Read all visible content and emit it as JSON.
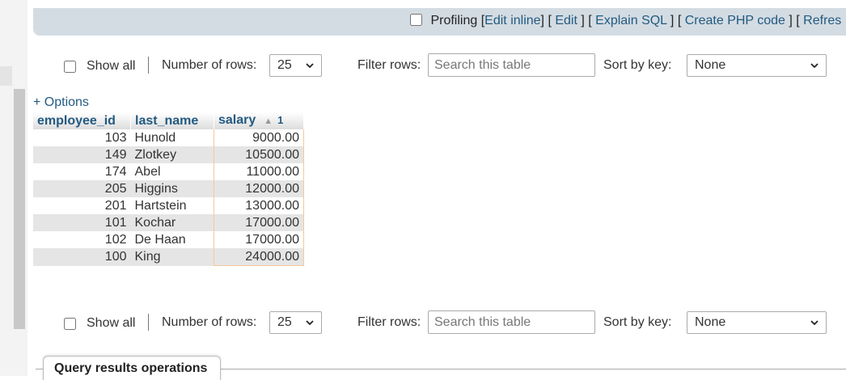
{
  "profiling": {
    "label": "Profiling",
    "bracket_open": "[",
    "links": [
      {
        "text": "Edit inline",
        "suffix": "] [ "
      },
      {
        "text": "Edit",
        "suffix": " ] [ "
      },
      {
        "text": "Explain SQL",
        "suffix": " ] [ "
      },
      {
        "text": "Create PHP code",
        "suffix": " ] [ "
      },
      {
        "text": "Refres",
        "suffix": ""
      }
    ]
  },
  "nav_top": {
    "show_all": "Show all",
    "number_of_rows_label": "Number of rows:",
    "number_of_rows_value": "25",
    "filter_label": "Filter rows:",
    "filter_placeholder": "Search this table",
    "sort_label": "Sort by key:",
    "sort_value": "None"
  },
  "nav_bottom": {
    "show_all": "Show all",
    "number_of_rows_label": "Number of rows:",
    "number_of_rows_value": "25",
    "filter_label": "Filter rows:",
    "filter_placeholder": "Search this table",
    "sort_label": "Sort by key:",
    "sort_value": "None"
  },
  "options_link": "+ Options",
  "table": {
    "columns": [
      "employee_id",
      "last_name",
      "salary"
    ],
    "sort_order_number": "1",
    "rows": [
      {
        "employee_id": "103",
        "last_name": "Hunold",
        "salary": "9000.00"
      },
      {
        "employee_id": "149",
        "last_name": "Zlotkey",
        "salary": "10500.00"
      },
      {
        "employee_id": "174",
        "last_name": "Abel",
        "salary": "11000.00"
      },
      {
        "employee_id": "205",
        "last_name": "Higgins",
        "salary": "12000.00"
      },
      {
        "employee_id": "201",
        "last_name": "Hartstein",
        "salary": "13000.00"
      },
      {
        "employee_id": "101",
        "last_name": "Kochar",
        "salary": "17000.00"
      },
      {
        "employee_id": "102",
        "last_name": "De Haan",
        "salary": "17000.00"
      },
      {
        "employee_id": "100",
        "last_name": "King",
        "salary": "24000.00"
      }
    ]
  },
  "query_results_operations": "Query results operations",
  "colors": {
    "link": "#235a81",
    "bar_bg": "#d3dce3",
    "row_even": "#e5e5e5",
    "highlight_border": "#f5c99a"
  }
}
